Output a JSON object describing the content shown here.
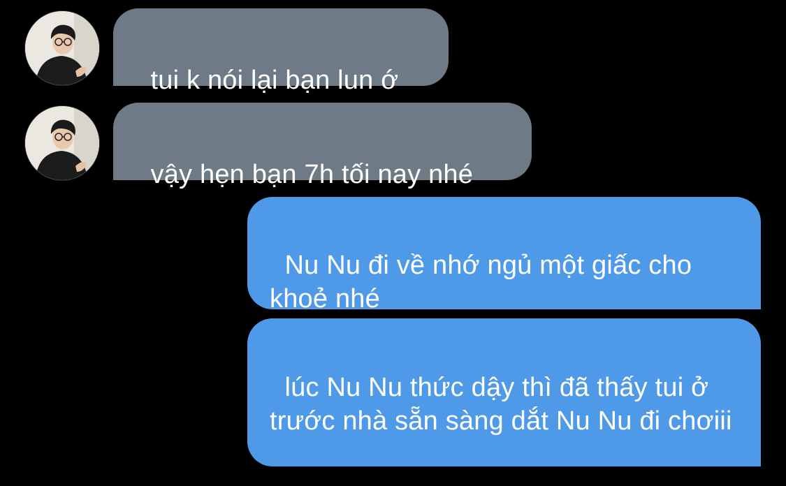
{
  "conversation": {
    "incoming": [
      {
        "text": "tui k nói lại bạn lun ớ"
      },
      {
        "text": "vậy hẹn bạn 7h tối nay nhé"
      }
    ],
    "outgoing": [
      {
        "text": "Nu Nu đi về nhớ ngủ một giấc cho khoẻ nhé"
      },
      {
        "text": "lúc Nu Nu thức dậy thì đã thấy tui ở trước nhà sẵn sàng dắt Nu Nu đi chơiii"
      }
    ]
  },
  "colors": {
    "background": "#000000",
    "incoming_bubble": "#6e7a86",
    "outgoing_bubble": "#4f9ae8",
    "text": "#ffffff"
  },
  "icons": {
    "avatar": "user-avatar-photo"
  }
}
